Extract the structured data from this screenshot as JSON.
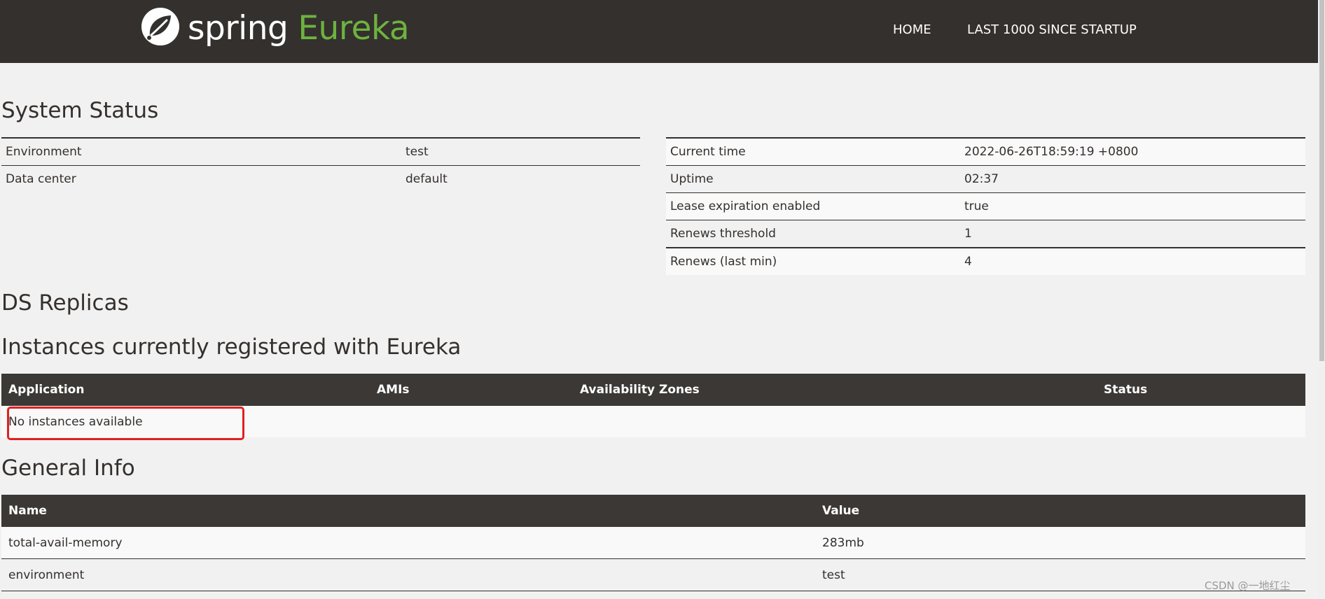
{
  "nav": {
    "logo_spring": "spring",
    "logo_eureka": "Eureka",
    "home": "HOME",
    "last1000": "LAST 1000 SINCE STARTUP"
  },
  "colors": {
    "navbar": "#34302d",
    "accent_green": "#6db33f",
    "highlight_red": "#e02020"
  },
  "icons": {
    "logo": "spring-leaf-icon"
  },
  "system_status": {
    "heading": "System Status",
    "left": [
      {
        "label": "Environment",
        "value": "test"
      },
      {
        "label": "Data center",
        "value": "default"
      }
    ],
    "right": [
      {
        "label": "Current time",
        "value": "2022-06-26T18:59:19 +0800"
      },
      {
        "label": "Uptime",
        "value": "02:37"
      },
      {
        "label": "Lease expiration enabled",
        "value": "true"
      },
      {
        "label": "Renews threshold",
        "value": "1"
      },
      {
        "label": "Renews (last min)",
        "value": "4"
      }
    ]
  },
  "ds_replicas": {
    "heading": "DS Replicas"
  },
  "instances": {
    "heading": "Instances currently registered with Eureka",
    "columns": [
      "Application",
      "AMIs",
      "Availability Zones",
      "Status"
    ],
    "empty_message": "No instances available"
  },
  "general_info": {
    "heading": "General Info",
    "columns": [
      "Name",
      "Value"
    ],
    "rows": [
      {
        "name": "total-avail-memory",
        "value": "283mb"
      },
      {
        "name": "environment",
        "value": "test"
      }
    ]
  },
  "watermark": "CSDN @一地红尘"
}
